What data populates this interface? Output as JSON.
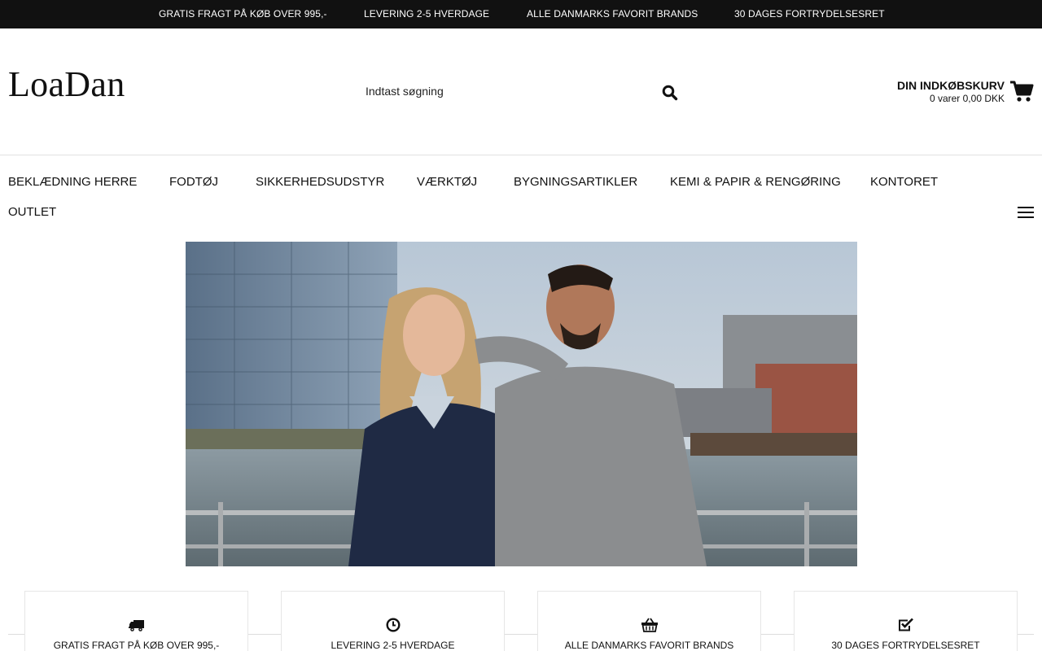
{
  "announcement": {
    "items": [
      "GRATIS FRAGT PÅ KØB OVER 995,-",
      "LEVERING 2-5 HVERDAGE",
      "ALLE DANMARKS FAVORIT BRANDS",
      "30 DAGES FORTRYDELSESRET"
    ]
  },
  "header": {
    "logo": "LoaDan",
    "search": {
      "placeholder": "Indtast søgning",
      "value": "",
      "icon": "search-icon"
    },
    "cart": {
      "title": "DIN INDKØBSKURV",
      "summary": "0 varer 0,00 DKK",
      "icon": "shopping-cart-icon"
    }
  },
  "nav": {
    "items": [
      "BEKLÆDNING HERRE",
      "FODTØJ",
      "SIKKERHEDSUDSTYR",
      "VÆRKTØJ",
      "BYGNINGSARTIKLER",
      "KEMI & PAPIR & RENGØRING",
      "KONTORET",
      "OUTLET"
    ],
    "menu_icon": "hamburger-menu-icon"
  },
  "hero": {
    "image": "couple-in-knitwear-on-waterfront-photo"
  },
  "usps": [
    {
      "icon": "truck-icon",
      "label": "GRATIS FRAGT PÅ KØB OVER 995,-"
    },
    {
      "icon": "clock-icon",
      "label": "LEVERING 2-5 HVERDAGE"
    },
    {
      "icon": "basket-icon",
      "label": "ALLE DANMARKS FAVORIT BRANDS"
    },
    {
      "icon": "check-square-icon",
      "label": "30 DAGES FORTRYDELSESRET"
    }
  ],
  "colors": {
    "topbar_bg": "#111111",
    "topbar_text": "#ffffff",
    "text": "#111111",
    "divider": "#e2e2e2"
  }
}
